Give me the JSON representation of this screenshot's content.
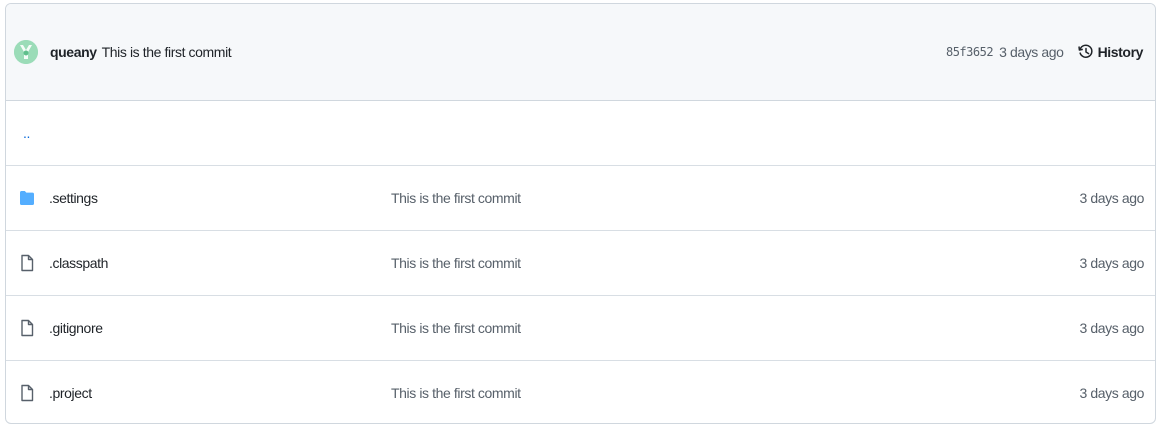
{
  "latest_commit": {
    "author": "queany",
    "message": "This is the first commit",
    "sha": "85f3652",
    "age": "3 days ago",
    "history_label": "History"
  },
  "parent_dir": "..",
  "files": [
    {
      "name": ".settings",
      "type": "folder",
      "icon": "folder-icon",
      "commit": "This is the first commit",
      "date": "3 days ago"
    },
    {
      "name": ".classpath",
      "type": "file",
      "icon": "file-icon",
      "commit": "This is the first commit",
      "date": "3 days ago"
    },
    {
      "name": ".gitignore",
      "type": "file",
      "icon": "file-icon",
      "commit": "This is the first commit",
      "date": "3 days ago"
    },
    {
      "name": ".project",
      "type": "file",
      "icon": "file-icon",
      "commit": "This is the first commit",
      "date": "3 days ago"
    }
  ],
  "colors": {
    "folder": "#54aeff",
    "link": "#0969da",
    "muted": "#57606a",
    "border": "#d0d7de",
    "header_bg": "#f6f8fa",
    "avatar": "#8fd6b0"
  }
}
